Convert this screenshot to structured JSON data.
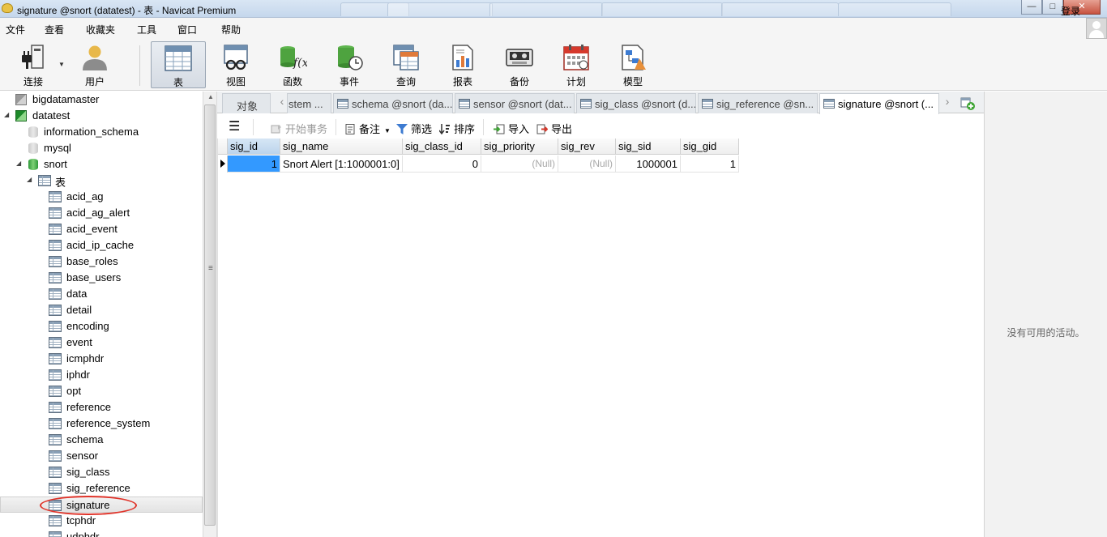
{
  "window": {
    "title": "signature @snort (datatest) - 表 - Navicat Premium",
    "controls": {
      "minimize": "—",
      "maximize": "□",
      "close": "✕"
    }
  },
  "menu": {
    "items": [
      "文件",
      "查看",
      "收藏夹",
      "工具",
      "窗口",
      "帮助"
    ],
    "login": "登录"
  },
  "toolbar": {
    "buttons": [
      {
        "label": "连接",
        "icon": "plug-icon"
      },
      {
        "label": "用户",
        "icon": "user-icon"
      },
      {
        "label": "表",
        "icon": "table-icon"
      },
      {
        "label": "视图",
        "icon": "view-icon"
      },
      {
        "label": "函数",
        "icon": "function-icon"
      },
      {
        "label": "事件",
        "icon": "event-icon"
      },
      {
        "label": "查询",
        "icon": "query-icon"
      },
      {
        "label": "报表",
        "icon": "report-icon"
      },
      {
        "label": "备份",
        "icon": "backup-icon"
      },
      {
        "label": "计划",
        "icon": "schedule-icon"
      },
      {
        "label": "模型",
        "icon": "model-icon"
      }
    ],
    "active": "表"
  },
  "tree": {
    "connections": [
      {
        "name": "bigdatamaster"
      },
      {
        "name": "datatest"
      }
    ],
    "databases": [
      "information_schema",
      "mysql",
      "snort"
    ],
    "tables_node": "表",
    "tables": [
      "acid_ag",
      "acid_ag_alert",
      "acid_event",
      "acid_ip_cache",
      "base_roles",
      "base_users",
      "data",
      "detail",
      "encoding",
      "event",
      "icmphdr",
      "iphdr",
      "opt",
      "reference",
      "reference_system",
      "schema",
      "sensor",
      "sig_class",
      "sig_reference",
      "signature",
      "tcphdr",
      "udphdr"
    ],
    "selected": "signature"
  },
  "tabs": {
    "object": "对象",
    "items": [
      "stem ...",
      "schema @snort (da...",
      "sensor @snort (dat...",
      "sig_class @snort (d...",
      "sig_reference @sn...",
      "signature @snort (..."
    ],
    "active_index": 5
  },
  "subtoolbar": {
    "begin_transaction": "开始事务",
    "memo": "备注",
    "filter": "筛选",
    "sort": "排序",
    "import": "导入",
    "export": "导出"
  },
  "grid": {
    "columns": [
      "sig_id",
      "sig_name",
      "sig_class_id",
      "sig_priority",
      "sig_rev",
      "sig_sid",
      "sig_gid"
    ],
    "rows": [
      [
        "1",
        "Snort Alert [1:1000001:0]",
        "0",
        "(Null)",
        "(Null)",
        "1000001",
        "1"
      ]
    ]
  },
  "right_panel": {
    "message": "没有可用的活动。"
  }
}
